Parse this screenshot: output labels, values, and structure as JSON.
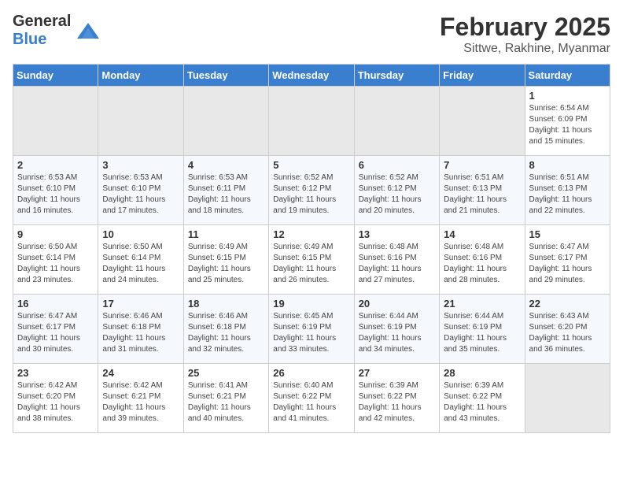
{
  "header": {
    "logo_general": "General",
    "logo_blue": "Blue",
    "title": "February 2025",
    "subtitle": "Sittwe, Rakhine, Myanmar"
  },
  "days_of_week": [
    "Sunday",
    "Monday",
    "Tuesday",
    "Wednesday",
    "Thursday",
    "Friday",
    "Saturday"
  ],
  "weeks": [
    [
      {
        "day": "",
        "empty": true
      },
      {
        "day": "",
        "empty": true
      },
      {
        "day": "",
        "empty": true
      },
      {
        "day": "",
        "empty": true
      },
      {
        "day": "",
        "empty": true
      },
      {
        "day": "",
        "empty": true
      },
      {
        "day": "1",
        "sunrise": "6:54 AM",
        "sunset": "6:09 PM",
        "daylight": "11 hours and 15 minutes."
      }
    ],
    [
      {
        "day": "2",
        "sunrise": "6:53 AM",
        "sunset": "6:10 PM",
        "daylight": "11 hours and 16 minutes."
      },
      {
        "day": "3",
        "sunrise": "6:53 AM",
        "sunset": "6:10 PM",
        "daylight": "11 hours and 17 minutes."
      },
      {
        "day": "4",
        "sunrise": "6:53 AM",
        "sunset": "6:11 PM",
        "daylight": "11 hours and 18 minutes."
      },
      {
        "day": "5",
        "sunrise": "6:52 AM",
        "sunset": "6:12 PM",
        "daylight": "11 hours and 19 minutes."
      },
      {
        "day": "6",
        "sunrise": "6:52 AM",
        "sunset": "6:12 PM",
        "daylight": "11 hours and 20 minutes."
      },
      {
        "day": "7",
        "sunrise": "6:51 AM",
        "sunset": "6:13 PM",
        "daylight": "11 hours and 21 minutes."
      },
      {
        "day": "8",
        "sunrise": "6:51 AM",
        "sunset": "6:13 PM",
        "daylight": "11 hours and 22 minutes."
      }
    ],
    [
      {
        "day": "9",
        "sunrise": "6:50 AM",
        "sunset": "6:14 PM",
        "daylight": "11 hours and 23 minutes."
      },
      {
        "day": "10",
        "sunrise": "6:50 AM",
        "sunset": "6:14 PM",
        "daylight": "11 hours and 24 minutes."
      },
      {
        "day": "11",
        "sunrise": "6:49 AM",
        "sunset": "6:15 PM",
        "daylight": "11 hours and 25 minutes."
      },
      {
        "day": "12",
        "sunrise": "6:49 AM",
        "sunset": "6:15 PM",
        "daylight": "11 hours and 26 minutes."
      },
      {
        "day": "13",
        "sunrise": "6:48 AM",
        "sunset": "6:16 PM",
        "daylight": "11 hours and 27 minutes."
      },
      {
        "day": "14",
        "sunrise": "6:48 AM",
        "sunset": "6:16 PM",
        "daylight": "11 hours and 28 minutes."
      },
      {
        "day": "15",
        "sunrise": "6:47 AM",
        "sunset": "6:17 PM",
        "daylight": "11 hours and 29 minutes."
      }
    ],
    [
      {
        "day": "16",
        "sunrise": "6:47 AM",
        "sunset": "6:17 PM",
        "daylight": "11 hours and 30 minutes."
      },
      {
        "day": "17",
        "sunrise": "6:46 AM",
        "sunset": "6:18 PM",
        "daylight": "11 hours and 31 minutes."
      },
      {
        "day": "18",
        "sunrise": "6:46 AM",
        "sunset": "6:18 PM",
        "daylight": "11 hours and 32 minutes."
      },
      {
        "day": "19",
        "sunrise": "6:45 AM",
        "sunset": "6:19 PM",
        "daylight": "11 hours and 33 minutes."
      },
      {
        "day": "20",
        "sunrise": "6:44 AM",
        "sunset": "6:19 PM",
        "daylight": "11 hours and 34 minutes."
      },
      {
        "day": "21",
        "sunrise": "6:44 AM",
        "sunset": "6:19 PM",
        "daylight": "11 hours and 35 minutes."
      },
      {
        "day": "22",
        "sunrise": "6:43 AM",
        "sunset": "6:20 PM",
        "daylight": "11 hours and 36 minutes."
      }
    ],
    [
      {
        "day": "23",
        "sunrise": "6:42 AM",
        "sunset": "6:20 PM",
        "daylight": "11 hours and 38 minutes."
      },
      {
        "day": "24",
        "sunrise": "6:42 AM",
        "sunset": "6:21 PM",
        "daylight": "11 hours and 39 minutes."
      },
      {
        "day": "25",
        "sunrise": "6:41 AM",
        "sunset": "6:21 PM",
        "daylight": "11 hours and 40 minutes."
      },
      {
        "day": "26",
        "sunrise": "6:40 AM",
        "sunset": "6:22 PM",
        "daylight": "11 hours and 41 minutes."
      },
      {
        "day": "27",
        "sunrise": "6:39 AM",
        "sunset": "6:22 PM",
        "daylight": "11 hours and 42 minutes."
      },
      {
        "day": "28",
        "sunrise": "6:39 AM",
        "sunset": "6:22 PM",
        "daylight": "11 hours and 43 minutes."
      },
      {
        "day": "",
        "empty": true
      }
    ]
  ],
  "labels": {
    "sunrise_prefix": "Sunrise: ",
    "sunset_prefix": "Sunset: ",
    "daylight_prefix": "Daylight: "
  }
}
